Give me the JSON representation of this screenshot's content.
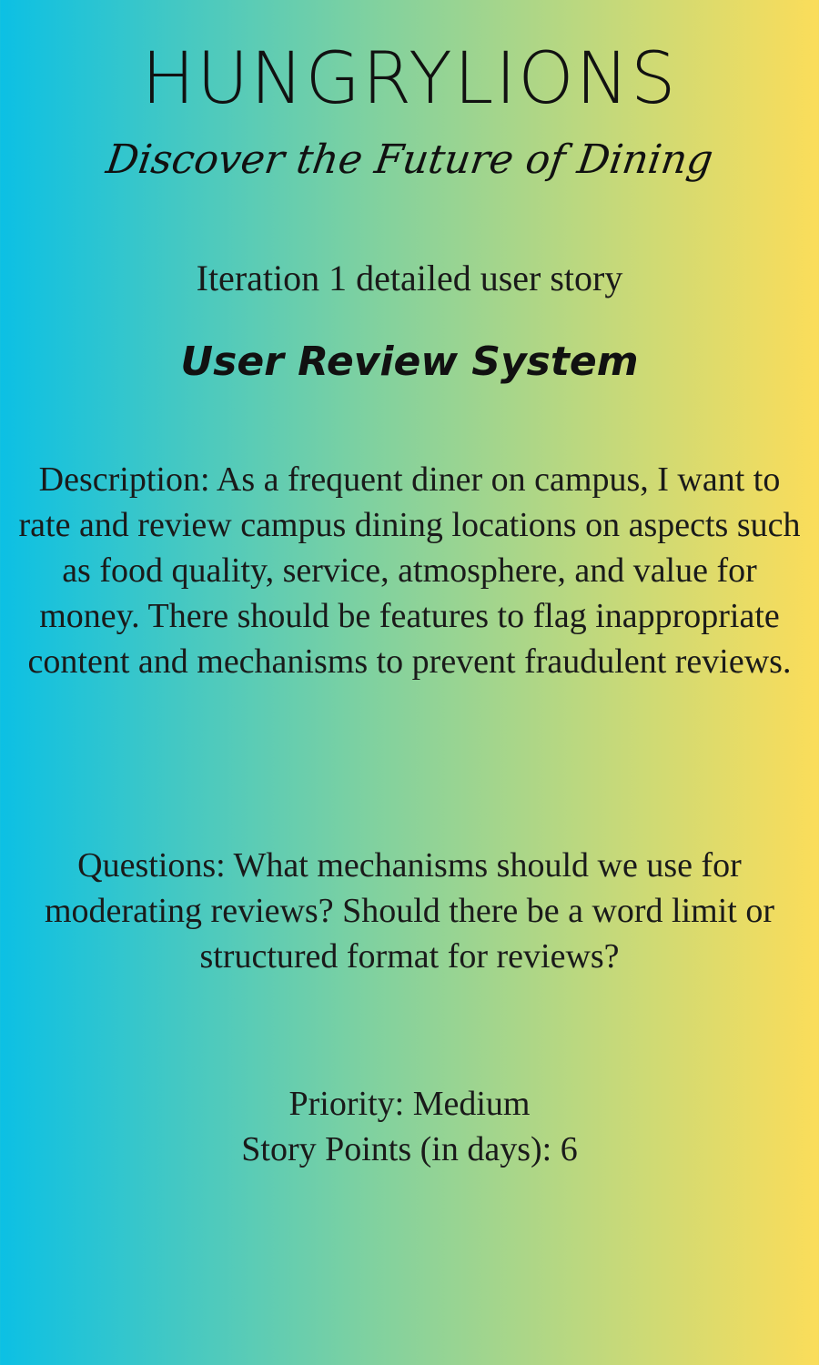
{
  "brand": {
    "name": "HUNGRYLIONS",
    "tagline": "Discover the Future of Dining"
  },
  "header": {
    "iteration": "Iteration 1 detailed user story"
  },
  "story": {
    "title": "User Review System",
    "description": "Description: As a frequent diner on campus, I want to rate and review campus dining locations on aspects such as food quality, service, atmosphere, and value for money. There should be features to flag inappropriate content and mechanisms to prevent fraudulent reviews.",
    "questions": "Questions: What mechanisms should we use for moderating reviews? Should there be a word limit or structured format for reviews?",
    "priority": "Priority: Medium",
    "story_points": "Story Points (in days): 6"
  },
  "colors": {
    "gradient_left": "#0cc0e4",
    "gradient_mid": "#7fd1a0",
    "gradient_right": "#fbdd5a",
    "text": "#1a1a1a"
  }
}
